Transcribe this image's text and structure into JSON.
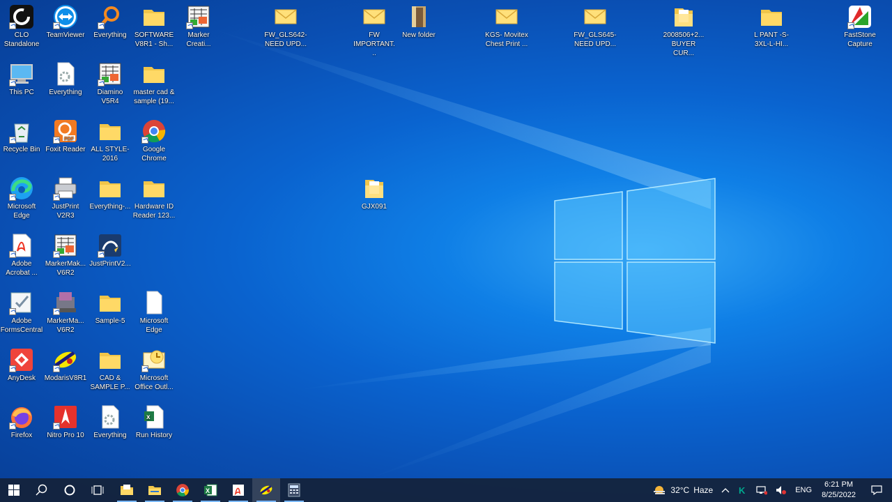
{
  "desktop": {
    "icons": [
      {
        "label": "CLO Standalone",
        "name": "clo-standalone-icon",
        "kind": "clo"
      },
      {
        "label": "TeamViewer",
        "name": "teamviewer-icon",
        "kind": "teamviewer"
      },
      {
        "label": "Everything",
        "name": "everything-search-icon",
        "kind": "everything"
      },
      {
        "label": "SOFTWARE V8R1 - Sh...",
        "name": "folder-icon",
        "kind": "folder"
      },
      {
        "label": "Marker Creati...",
        "name": "marker-creation-icon",
        "kind": "marker"
      },
      {
        "label": "FW_GLS642- NEED UPD...",
        "name": "email-message-icon",
        "kind": "mail"
      },
      {
        "label": "FW IMPORTANT...",
        "name": "email-message-icon",
        "kind": "mail"
      },
      {
        "label": "New folder",
        "name": "folder-open-icon",
        "kind": "folder-open"
      },
      {
        "label": "KGS- Movitex Chest Print ...",
        "name": "email-message-icon",
        "kind": "mail"
      },
      {
        "label": "FW_GLS645- NEED UPD...",
        "name": "email-message-icon",
        "kind": "mail"
      },
      {
        "label": "2008506+2... BUYER CUR...",
        "name": "folder-icon",
        "kind": "folder-doc"
      },
      {
        "label": "L PANT -S-3XL-L-HI...",
        "name": "folder-icon",
        "kind": "folder"
      },
      {
        "label": "FastStone Capture",
        "name": "faststone-capture-icon",
        "kind": "faststone"
      },
      {
        "label": "This PC",
        "name": "this-pc-icon",
        "kind": "pc"
      },
      {
        "label": "Everything",
        "name": "everything-file-icon",
        "kind": "gearfile"
      },
      {
        "label": "Diamino V5R4",
        "name": "diamino-icon",
        "kind": "marker"
      },
      {
        "label": "master cad & sample (19...",
        "name": "folder-icon",
        "kind": "folder"
      },
      {
        "label": "Recycle Bin",
        "name": "recycle-bin-icon",
        "kind": "recycle"
      },
      {
        "label": "Foxit Reader",
        "name": "foxit-reader-icon",
        "kind": "foxit"
      },
      {
        "label": "ALL STYLE-2016",
        "name": "folder-icon",
        "kind": "folder"
      },
      {
        "label": "Google Chrome",
        "name": "chrome-icon",
        "kind": "chrome"
      },
      {
        "label": "Microsoft Edge",
        "name": "edge-icon",
        "kind": "edge"
      },
      {
        "label": "JustPrint V2R3",
        "name": "justprint-icon",
        "kind": "printer"
      },
      {
        "label": "Everything-...",
        "name": "folder-icon",
        "kind": "folder"
      },
      {
        "label": "Hardware ID Reader 123...",
        "name": "folder-icon",
        "kind": "folder"
      },
      {
        "label": "GJX091",
        "name": "folder-icon",
        "kind": "folder-doc"
      },
      {
        "label": "Adobe Acrobat ...",
        "name": "adobe-acrobat-icon",
        "kind": "acrobat"
      },
      {
        "label": "MarkerMak... V6R2",
        "name": "markermaker-icon",
        "kind": "marker"
      },
      {
        "label": "JustPrintV2...",
        "name": "justprint-v2-icon",
        "kind": "justprint2"
      },
      {
        "label": "Adobe FormsCentral",
        "name": "forms-central-icon",
        "kind": "forms"
      },
      {
        "label": "MarkerMa... V6R2",
        "name": "markermaker-icon",
        "kind": "mm2"
      },
      {
        "label": "Sample-5",
        "name": "folder-icon",
        "kind": "folder"
      },
      {
        "label": "Microsoft Edge",
        "name": "blank-file-icon",
        "kind": "blank"
      },
      {
        "label": "AnyDesk",
        "name": "anydesk-icon",
        "kind": "anydesk"
      },
      {
        "label": "ModarisV8R1",
        "name": "modaris-icon",
        "kind": "modaris"
      },
      {
        "label": "CAD & SAMPLE P...",
        "name": "folder-icon",
        "kind": "folder"
      },
      {
        "label": "Microsoft Office Outl...",
        "name": "outlook-icon",
        "kind": "outlook"
      },
      {
        "label": "Firefox",
        "name": "firefox-icon",
        "kind": "firefox"
      },
      {
        "label": "Nitro Pro 10",
        "name": "nitro-pro-icon",
        "kind": "nitro"
      },
      {
        "label": "Everything",
        "name": "everything-file-icon",
        "kind": "gearfile"
      },
      {
        "label": "Run History",
        "name": "excel-file-icon",
        "kind": "excelfile"
      }
    ]
  },
  "taskbar": {
    "apps": [
      {
        "name": "start-button",
        "kind": "start"
      },
      {
        "name": "search-icon",
        "kind": "search"
      },
      {
        "name": "cortana-icon",
        "kind": "cortana"
      },
      {
        "name": "task-view-icon",
        "kind": "taskview"
      },
      {
        "name": "taskbar-file-explorer-folder",
        "kind": "folderopen"
      },
      {
        "name": "taskbar-file-explorer",
        "kind": "explorer"
      },
      {
        "name": "taskbar-chrome",
        "kind": "chrome"
      },
      {
        "name": "taskbar-excel",
        "kind": "excel"
      },
      {
        "name": "taskbar-acrobat",
        "kind": "acrobat"
      },
      {
        "name": "taskbar-modaris",
        "kind": "modaris"
      },
      {
        "name": "taskbar-calculator",
        "kind": "calc"
      }
    ],
    "weather": {
      "temp": "32°C",
      "condition": "Haze"
    },
    "language": "ENG",
    "time": "6:21 PM",
    "date": "8/25/2022"
  }
}
